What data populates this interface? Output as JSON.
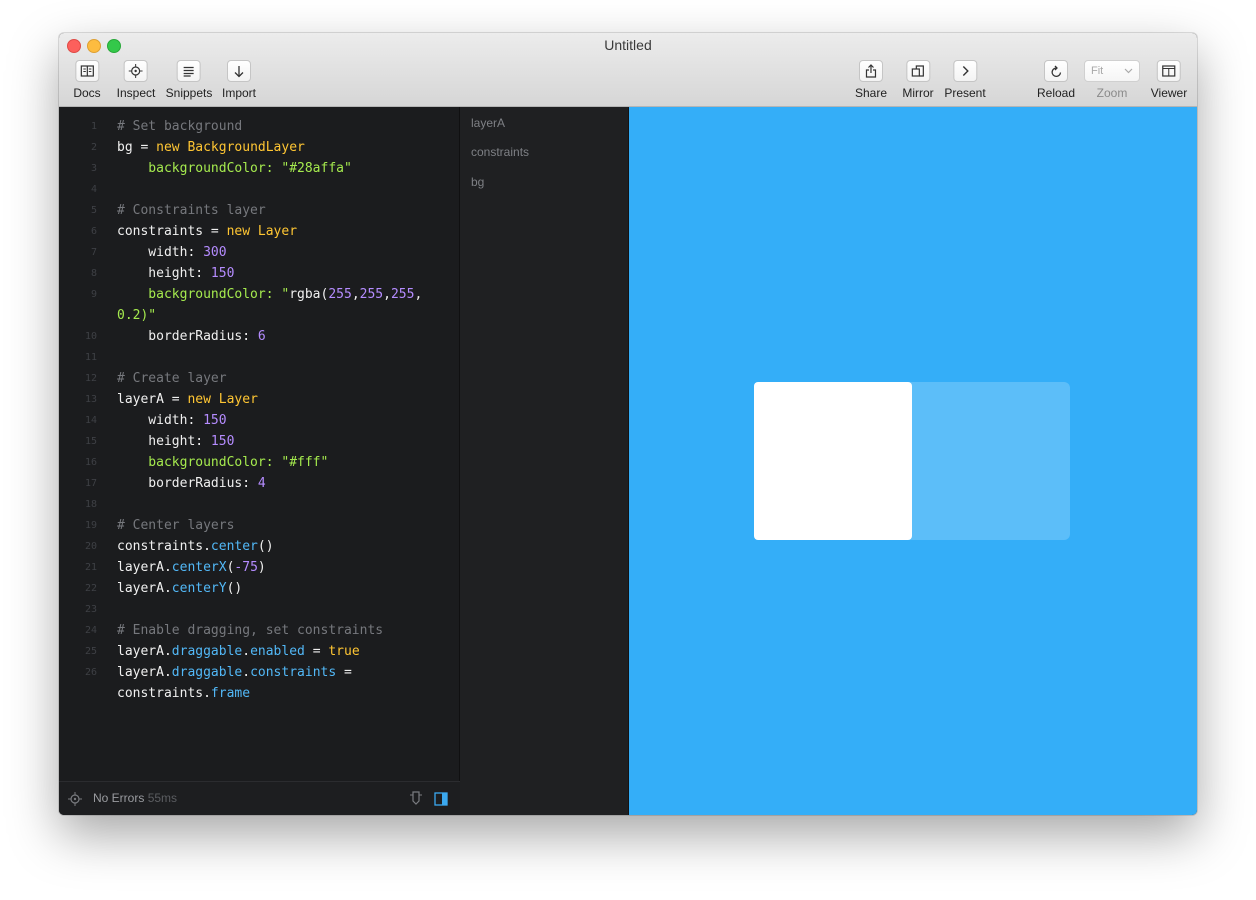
{
  "window": {
    "title": "Untitled"
  },
  "toolbar": {
    "left": [
      {
        "label": "Docs",
        "icon": "book-icon"
      },
      {
        "label": "Inspect",
        "icon": "crosshair-icon"
      },
      {
        "label": "Snippets",
        "icon": "list-icon"
      },
      {
        "label": "Import",
        "icon": "arrow-down-icon"
      }
    ],
    "right": [
      {
        "label": "Share",
        "icon": "share-icon"
      },
      {
        "label": "Mirror",
        "icon": "mirror-icon"
      },
      {
        "label": "Present",
        "icon": "chevron-right-icon"
      },
      {
        "label": "Reload",
        "icon": "reload-icon"
      },
      {
        "label": "Zoom",
        "value": "Fit"
      },
      {
        "label": "Viewer",
        "icon": "viewer-icon"
      }
    ]
  },
  "editor": {
    "lines": [
      {
        "n": "1",
        "text": "# Set background"
      },
      {
        "n": "2",
        "text": "bg = new BackgroundLayer"
      },
      {
        "n": "3",
        "text": "    backgroundColor: \"#28affa\""
      },
      {
        "n": "4",
        "text": ""
      },
      {
        "n": "5",
        "text": "# Constraints layer"
      },
      {
        "n": "6",
        "text": "constraints = new Layer"
      },
      {
        "n": "7",
        "text": "    width: 300"
      },
      {
        "n": "8",
        "text": "    height: 150"
      },
      {
        "n": "9",
        "text": "    backgroundColor: \"rgba(255,255,255,"
      },
      {
        "n": "",
        "text": "0.2)\""
      },
      {
        "n": "10",
        "text": "    borderRadius: 6"
      },
      {
        "n": "11",
        "text": ""
      },
      {
        "n": "12",
        "text": "# Create layer"
      },
      {
        "n": "13",
        "text": "layerA = new Layer"
      },
      {
        "n": "14",
        "text": "    width: 150"
      },
      {
        "n": "15",
        "text": "    height: 150"
      },
      {
        "n": "16",
        "text": "    backgroundColor: \"#fff\""
      },
      {
        "n": "17",
        "text": "    borderRadius: 4"
      },
      {
        "n": "18",
        "text": ""
      },
      {
        "n": "19",
        "text": "# Center layers"
      },
      {
        "n": "20",
        "text": "constraints.center()"
      },
      {
        "n": "21",
        "text": "layerA.centerX(-75)"
      },
      {
        "n": "22",
        "text": "layerA.centerY()"
      },
      {
        "n": "23",
        "text": ""
      },
      {
        "n": "24",
        "text": "# Enable dragging, set constraints"
      },
      {
        "n": "25",
        "text": "layerA.draggable.enabled = true"
      },
      {
        "n": "26",
        "text": "layerA.draggable.constraints ="
      },
      {
        "n": "",
        "text": "constraints.frame"
      }
    ]
  },
  "status": {
    "text": "No Errors",
    "time": "55ms"
  },
  "layers": [
    "layerA",
    "constraints",
    "bg"
  ],
  "colors": {
    "preview_bg": "#34aef8",
    "comment": "#76787d",
    "keyword": "#ffc633",
    "string": "#a5ea4e",
    "number": "#b58cff",
    "method": "#52b8f7",
    "identifier": "#f0f0f0"
  }
}
